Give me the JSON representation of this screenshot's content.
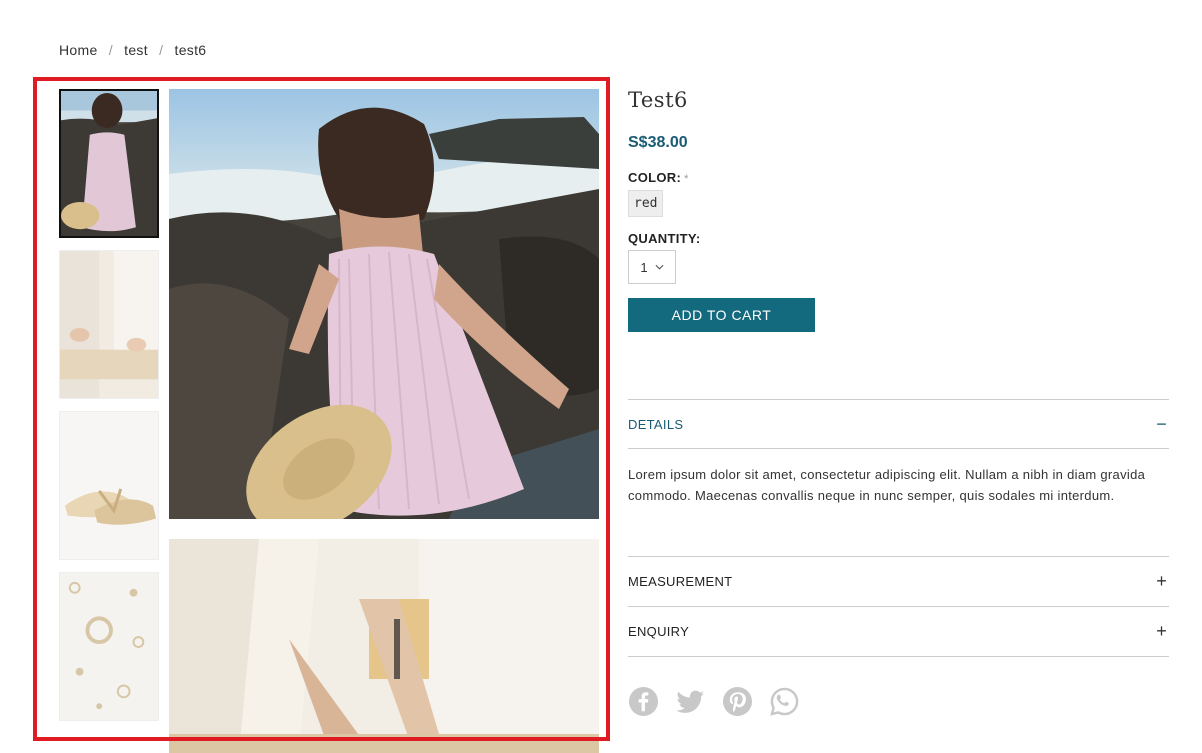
{
  "breadcrumb": {
    "home": "Home",
    "category": "test",
    "current": "test6",
    "separator": "/"
  },
  "product": {
    "title": "Test6",
    "price": "S$38.00",
    "color_label": "COLOR:",
    "required_mark": "*",
    "color_option": "red",
    "quantity_label": "QUANTITY:",
    "quantity_value": "1",
    "add_to_cart": "ADD TO CART"
  },
  "accordion": {
    "details": {
      "label": "DETAILS",
      "sign": "−",
      "body": "Lorem ipsum dolor sit amet, consectetur adipiscing elit. Nullam a nibh in diam gravida commodo. Maecenas convallis neque in nunc semper, quis sodales mi interdum."
    },
    "measurement": {
      "label": "MEASUREMENT",
      "sign": "+"
    },
    "enquiry": {
      "label": "ENQUIRY",
      "sign": "+"
    }
  },
  "social_icons": [
    "facebook-icon",
    "twitter-icon",
    "pinterest-icon",
    "whatsapp-icon"
  ],
  "colors": {
    "accent": "#1a5b73",
    "button": "#13697d",
    "highlight": "#e01b24"
  }
}
